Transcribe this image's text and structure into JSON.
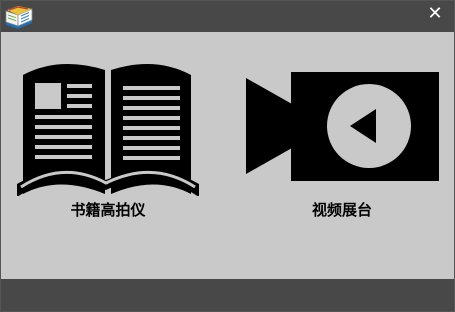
{
  "window": {
    "close_symbol": "✕",
    "icon": "book-icon"
  },
  "tiles": [
    {
      "label": "书籍高拍仪",
      "icon": "open-book-icon"
    },
    {
      "label": "视频展台",
      "icon": "video-camera-icon"
    }
  ],
  "colors": {
    "titlebar": "#484848",
    "content_bg": "#c9c9c9",
    "icon_fill": "#000000",
    "close_text": "#ffffff"
  }
}
